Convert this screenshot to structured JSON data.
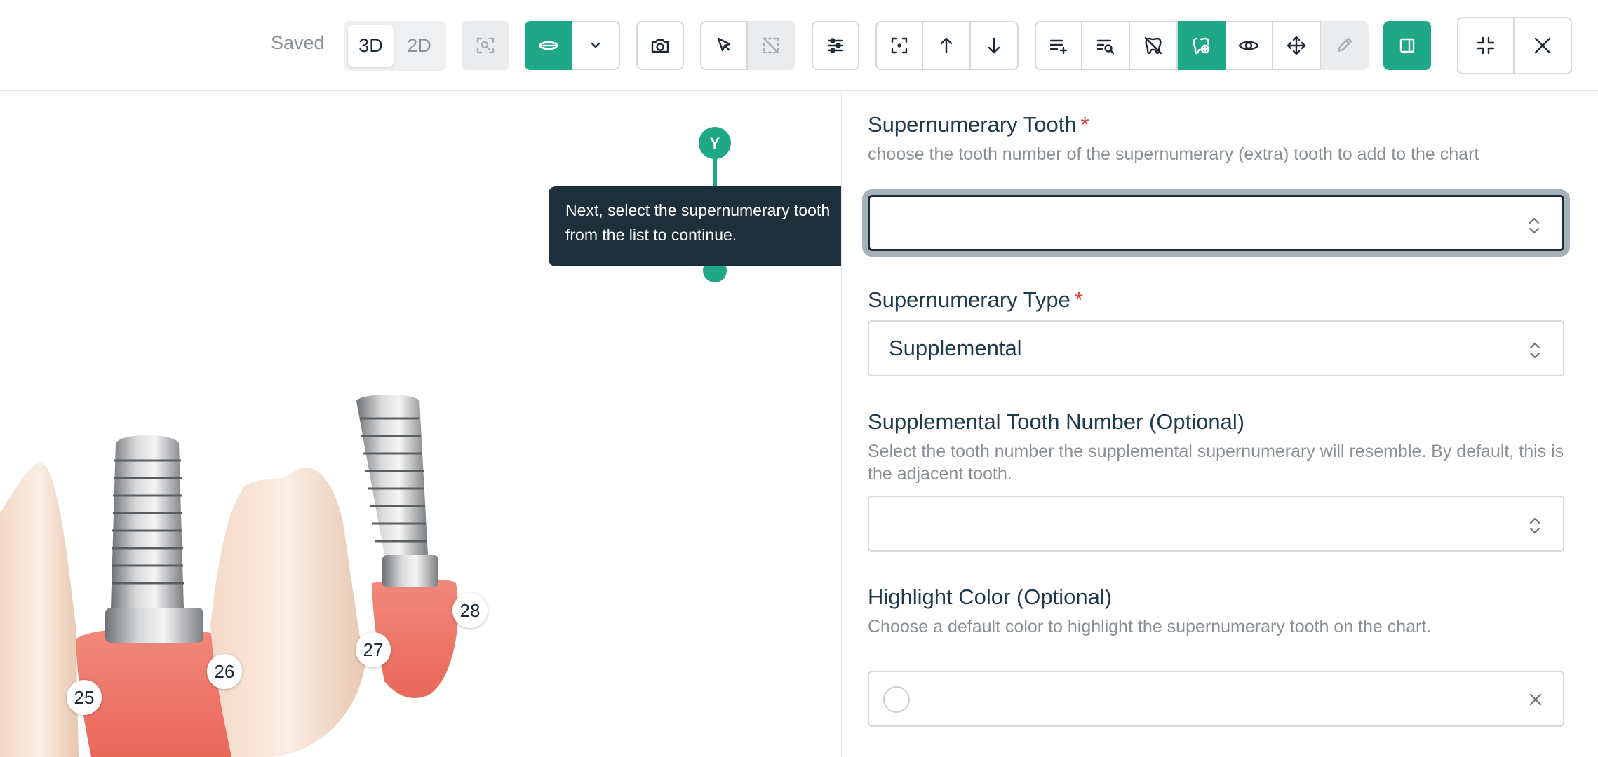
{
  "toolbar": {
    "status_text": "Saved",
    "view_mode": {
      "options": [
        "3D",
        "2D"
      ],
      "selected": "3D"
    }
  },
  "viewport": {
    "axis_label": "Y",
    "tooltip_text": "Next, select the supernumerary tooth from the list to continue.",
    "tooth_labels": [
      "25",
      "26",
      "27",
      "28"
    ]
  },
  "form": {
    "supernumerary_tooth": {
      "label": "Supernumerary Tooth",
      "required_mark": "*",
      "help": "choose the tooth number of the supernumerary (extra) tooth to add to the chart",
      "value": ""
    },
    "supernumerary_type": {
      "label": "Supernumerary Type",
      "required_mark": "*",
      "value": "Supplemental"
    },
    "supplemental_tooth_number": {
      "label": "Supplemental Tooth Number (Optional)",
      "help": "Select the tooth number the supplemental supernumerary will resemble. By default, this is the adjacent tooth.",
      "value": ""
    },
    "highlight_color": {
      "label": "Highlight Color (Optional)",
      "help": "Choose a default color to highlight the supernumerary tooth on the chart.",
      "value": ""
    }
  },
  "colors": {
    "accent": "#1fa888",
    "tooltip_bg": "#1d2f3b",
    "gum": "#f07a6c",
    "required": "#e03a3a"
  }
}
